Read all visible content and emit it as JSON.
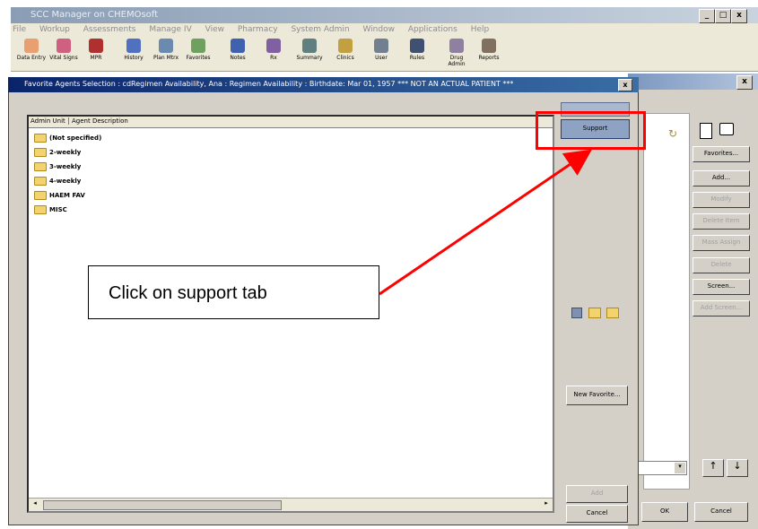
{
  "app": {
    "title": "SCC Manager on CHEMOsoft",
    "menu": [
      "File",
      "Workup",
      "Assessments",
      "Manage IV",
      "View",
      "Pharmacy",
      "System Admin",
      "Window",
      "Applications",
      "Help"
    ],
    "toolbar": [
      "Data Entry",
      "Vital Signs",
      "MPR",
      "History",
      "Plan Mtrx",
      "Favorites",
      "Notes",
      "Rx",
      "Summary",
      "Clinics",
      "User",
      "Rules",
      "Drug Admin",
      "Reports"
    ]
  },
  "dialog": {
    "title": "Favorite Agents Selection : cdRegimen Availability, Ana : Regimen Availability : Birthdate: Mar 01, 1957 *** NOT AN ACTUAL PATIENT ***",
    "close_label": "x",
    "columns": [
      "Admin Unit",
      "Agent Description"
    ],
    "items": [
      "(Not specified)",
      "2-weekly",
      "3-weekly",
      "4-weekly",
      "HAEM FAV",
      "MISC"
    ],
    "tabs": {
      "top": "",
      "support": "Support"
    },
    "new_favorite": "New Favorite...",
    "add": "Add",
    "cancel": "Cancel"
  },
  "right_panel": {
    "close_label": "x",
    "buttons": [
      "Favorites...",
      "Add...",
      "Modify",
      "Delete Item",
      "Mass Assign",
      "Delete",
      "Screen...",
      "Add Screen..."
    ],
    "ok": "OK",
    "cancel": "Cancel"
  },
  "annotation": {
    "callout": "Click on support tab",
    "highlight_color": "#ff0000"
  }
}
